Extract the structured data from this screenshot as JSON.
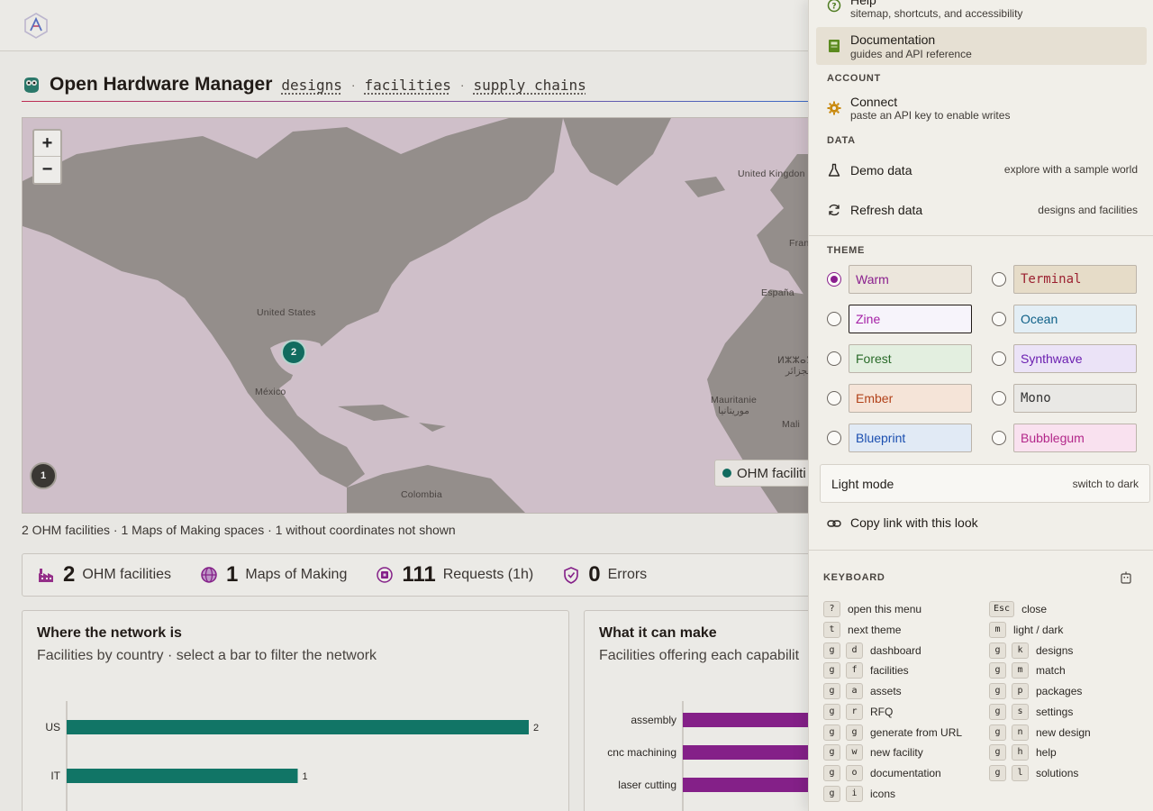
{
  "header": {
    "title": "Open Hardware Manager",
    "links": [
      "designs",
      "facilities",
      "supply chains"
    ],
    "separator": "·"
  },
  "map": {
    "zoom_in": "+",
    "zoom_out": "−",
    "labels": {
      "united_states": "United States",
      "mexico": "México",
      "colombia": "Colombia",
      "united_kingdom": "United Kingdon",
      "france": "Fran",
      "espana": "España",
      "algeria": "ⵍⵣⵣⴰⵢⵔ\nالجزائر",
      "mauritanie": "Mauritanie\nموريتانيا",
      "mali": "Mali"
    },
    "clusters": {
      "north_america": "2",
      "pacific": "1"
    },
    "legend": "OHM faciliti",
    "caption": "2 OHM facilities · 1 Maps of Making spaces · 1 without coordinates not shown"
  },
  "stats": [
    {
      "value": "2",
      "label": "OHM facilities",
      "icon": "factory-icon"
    },
    {
      "value": "1",
      "label": "Maps of Making",
      "icon": "globe-icon"
    },
    {
      "value": "111",
      "label": "Requests (1h)",
      "icon": "chip-icon"
    },
    {
      "value": "0",
      "label": "Errors",
      "icon": "shield-icon"
    }
  ],
  "cards": {
    "where": {
      "title": "Where the network is",
      "subtitle": "Facilities by country · select a bar to filter the network"
    },
    "what": {
      "title": "What it can make",
      "subtitle": "Facilities offering each capabilit"
    }
  },
  "chart_data": [
    {
      "type": "bar",
      "orientation": "horizontal",
      "categories": [
        "US",
        "IT"
      ],
      "values": [
        2,
        1
      ],
      "data_labels": [
        "2",
        "1"
      ],
      "xlim": [
        0,
        2
      ],
      "xticks": [
        "0",
        "0.5",
        "1",
        "1.5",
        "2"
      ],
      "color": "#0f7a6a"
    },
    {
      "type": "bar",
      "orientation": "horizontal",
      "categories": [
        "assembly",
        "cnc machining",
        "laser cutting"
      ],
      "values": [
        1,
        1,
        1
      ],
      "xticks": [
        "0",
        "0.2"
      ],
      "color": "#8a1f8e"
    }
  ],
  "menu": {
    "help": {
      "title": "Help",
      "sub": "sitemap, shortcuts, and accessibility"
    },
    "documentation": {
      "title": "Documentation",
      "sub": "guides and API reference"
    },
    "account_label": "ACCOUNT",
    "connect": {
      "title": "Connect",
      "sub": "paste an API key to enable writes"
    },
    "data_label": "DATA",
    "demo": {
      "title": "Demo data",
      "right": "explore with a sample world"
    },
    "refresh": {
      "title": "Refresh data",
      "right": "designs and facilities"
    },
    "theme_label": "THEME",
    "themes": [
      {
        "name": "Warm",
        "selected": true,
        "bg": "#ece6dc",
        "fg": "#8a1f8e"
      },
      {
        "name": "Terminal",
        "selected": false,
        "bg": "#e6dcc8",
        "fg": "#9b2030"
      },
      {
        "name": "Zine",
        "selected": false,
        "bg": "#f7f4fb",
        "fg": "#a41fa6"
      },
      {
        "name": "Ocean",
        "selected": false,
        "bg": "#e3eef5",
        "fg": "#0d5f87"
      },
      {
        "name": "Forest",
        "selected": false,
        "bg": "#e3efe0",
        "fg": "#2a6b2a"
      },
      {
        "name": "Synthwave",
        "selected": false,
        "bg": "#ebe3f7",
        "fg": "#6b1fb0"
      },
      {
        "name": "Ember",
        "selected": false,
        "bg": "#f5e4d8",
        "fg": "#b2421a"
      },
      {
        "name": "Mono",
        "selected": false,
        "bg": "#e9e8e5",
        "fg": "#333333"
      },
      {
        "name": "Blueprint",
        "selected": false,
        "bg": "#e1eaf5",
        "fg": "#1b4fb0"
      },
      {
        "name": "Bubblegum",
        "selected": false,
        "bg": "#f9e1ef",
        "fg": "#b3278a"
      }
    ],
    "light_mode": {
      "title": "Light mode",
      "sub": "switch to dark"
    },
    "copy_link": "Copy link with this look"
  },
  "keyboard": {
    "label": "KEYBOARD",
    "left": [
      {
        "keys": [
          "?"
        ],
        "desc": "open this menu"
      },
      {
        "keys": [
          "t"
        ],
        "desc": "next theme"
      },
      {
        "keys": [
          "g",
          "d"
        ],
        "desc": "dashboard"
      },
      {
        "keys": [
          "g",
          "f"
        ],
        "desc": "facilities"
      },
      {
        "keys": [
          "g",
          "a"
        ],
        "desc": "assets"
      },
      {
        "keys": [
          "g",
          "r"
        ],
        "desc": "RFQ"
      },
      {
        "keys": [
          "g",
          "g"
        ],
        "desc": "generate from URL"
      },
      {
        "keys": [
          "g",
          "w"
        ],
        "desc": "new facility"
      },
      {
        "keys": [
          "g",
          "o"
        ],
        "desc": "documentation"
      },
      {
        "keys": [
          "g",
          "i"
        ],
        "desc": "icons"
      }
    ],
    "right": [
      {
        "keys": [
          "Esc"
        ],
        "desc": "close"
      },
      {
        "keys": [
          "m"
        ],
        "desc": "light / dark"
      },
      {
        "keys": [
          "g",
          "k"
        ],
        "desc": "designs"
      },
      {
        "keys": [
          "g",
          "m"
        ],
        "desc": "match"
      },
      {
        "keys": [
          "g",
          "p"
        ],
        "desc": "packages"
      },
      {
        "keys": [
          "g",
          "s"
        ],
        "desc": "settings"
      },
      {
        "keys": [
          "g",
          "n"
        ],
        "desc": "new design"
      },
      {
        "keys": [
          "g",
          "h"
        ],
        "desc": "help"
      },
      {
        "keys": [
          "g",
          "l"
        ],
        "desc": "solutions"
      }
    ]
  }
}
